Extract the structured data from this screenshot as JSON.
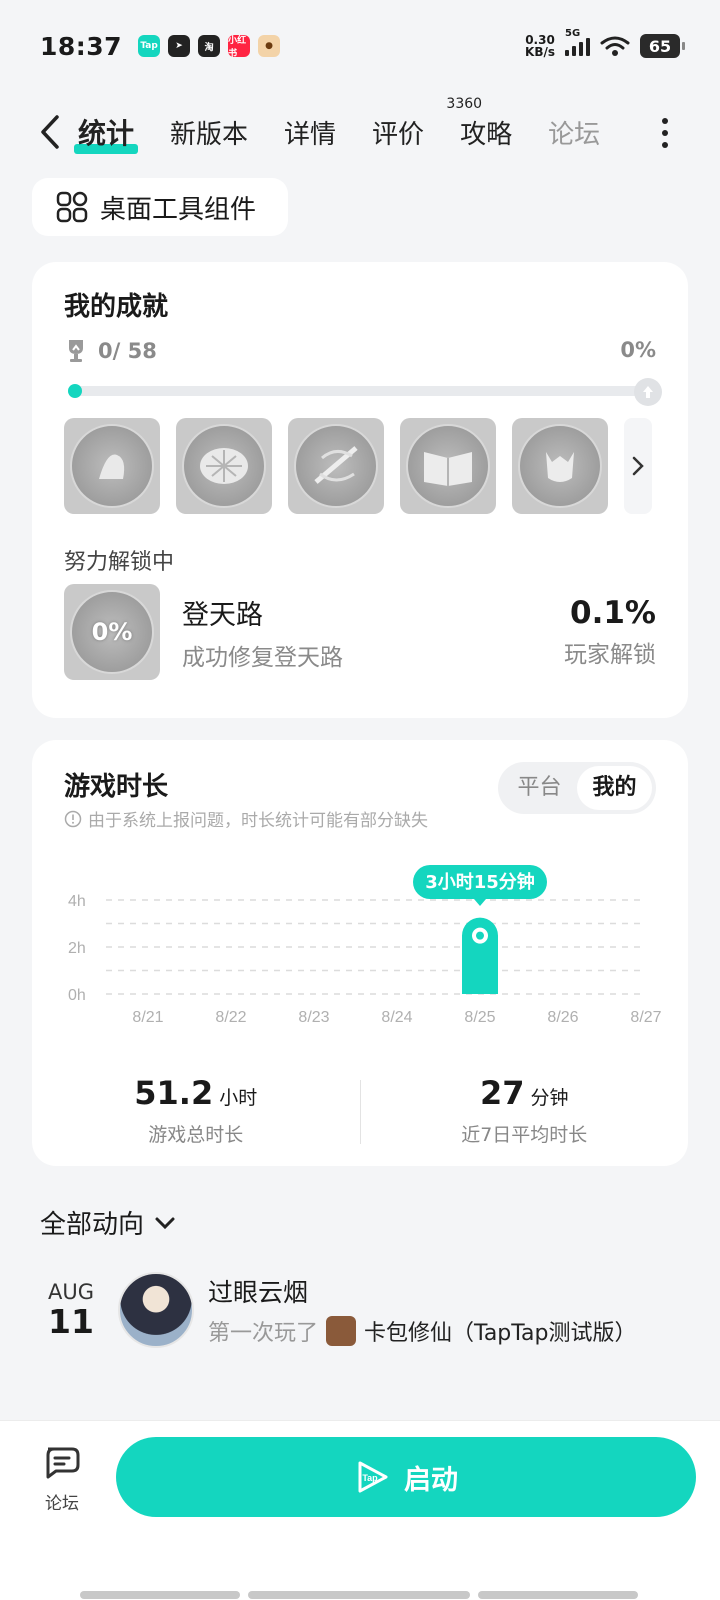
{
  "status": {
    "time": "18:37",
    "speed_value": "0.30",
    "speed_unit": "KB/s",
    "network": "5G",
    "battery": "65",
    "apps": [
      "Tap",
      "飞",
      "淘",
      "小红书",
      "猴"
    ]
  },
  "tabs": [
    {
      "label": "统计",
      "active": true
    },
    {
      "label": "新版本"
    },
    {
      "label": "详情"
    },
    {
      "label": "评价",
      "badge": "3360"
    },
    {
      "label": "攻略"
    },
    {
      "label": "论坛"
    }
  ],
  "widget_button": {
    "label": "桌面工具组件",
    "icon": "widget-grid-icon"
  },
  "achievements": {
    "title": "我的成就",
    "count": "0/ 58",
    "percent": "0%",
    "progress": 0,
    "badges": [
      "超飞风",
      "乌龟",
      "剑",
      "书",
      "狐"
    ],
    "unlocking_label": "努力解锁中",
    "unlocking": {
      "badge_text": "0%",
      "name": "登天路",
      "desc": "成功修复登天路",
      "pct": "0.1%",
      "sub": "玩家解锁"
    }
  },
  "playtime": {
    "title": "游戏时长",
    "notice": "由于系统上报问题，时长统计可能有部分缺失",
    "segment": [
      "平台",
      "我的"
    ],
    "segment_active": "我的",
    "total_value": "51.2",
    "total_unit": "小时",
    "total_label": "游戏总时长",
    "avg_value": "27",
    "avg_unit": "分钟",
    "avg_label": "近7日平均时长"
  },
  "chart_data": {
    "type": "bar",
    "categories": [
      "8/21",
      "8/22",
      "8/23",
      "8/24",
      "8/25",
      "8/26",
      "8/27"
    ],
    "values": [
      0,
      0,
      0,
      0,
      3.25,
      0,
      0
    ],
    "y_ticks": [
      "0h",
      "2h",
      "4h"
    ],
    "ylim": [
      0,
      4
    ],
    "tooltip": "3小时15分钟",
    "color": "#14d6bf",
    "grid": true
  },
  "feed": {
    "title": "全部动向",
    "items": [
      {
        "month": "AUG",
        "day": "11",
        "user": "过眼云烟",
        "action": "第一次玩了",
        "game": "卡包修仙（TapTap测试版）"
      }
    ]
  },
  "bottom": {
    "forum_label": "论坛",
    "start_label": "启动"
  },
  "colors": {
    "accent": "#14d6bf"
  }
}
